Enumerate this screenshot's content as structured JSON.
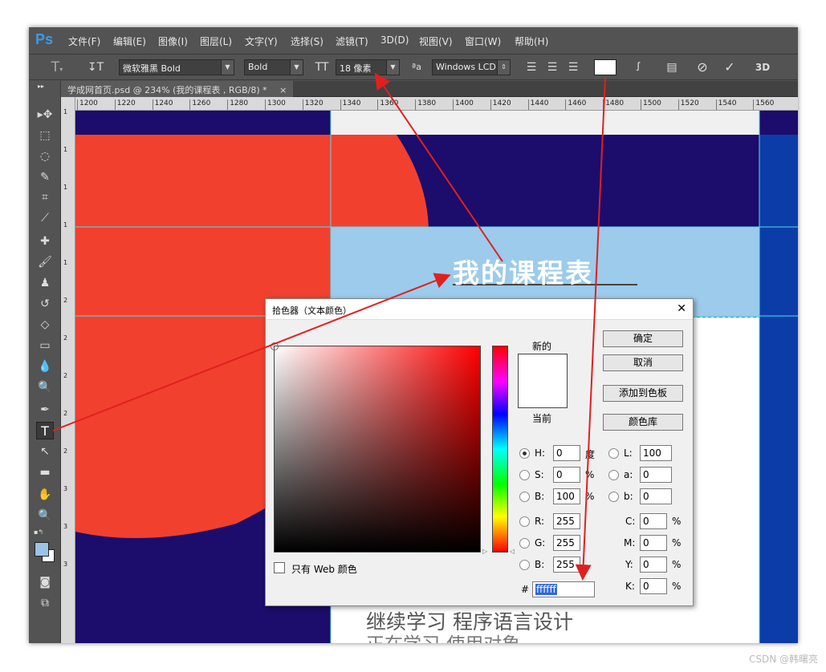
{
  "app": {
    "logo": "Ps"
  },
  "menu": [
    "文件(F)",
    "编辑(E)",
    "图像(I)",
    "图层(L)",
    "文字(Y)",
    "选择(S)",
    "滤镜(T)",
    "3D(D)",
    "视图(V)",
    "窗口(W)",
    "帮助(H)"
  ],
  "options": {
    "font_family": "微软雅黑 Bold",
    "font_style": "Bold",
    "font_size": "18 像素",
    "aa_label": "ªa",
    "antialias": "Windows LCD",
    "label_3d": "3D",
    "text_color": "#ffffff"
  },
  "document": {
    "tab_title": "学成网首页.psd @ 234% (我的课程表 , RGB/8) *",
    "close": "×"
  },
  "ruler": {
    "h": [
      "1200",
      "1220",
      "1240",
      "1260",
      "1280",
      "1300",
      "1320",
      "1340",
      "1360",
      "1380",
      "1400",
      "1420",
      "1440",
      "1460",
      "1480",
      "1500",
      "1520",
      "1540",
      "1560"
    ],
    "v": [
      "1",
      "1",
      "1",
      "1",
      "1",
      "2",
      "2",
      "2",
      "2",
      "2",
      "3",
      "3",
      "3"
    ]
  },
  "canvas": {
    "heading": "我的课程表",
    "line1": "继续学习 程序语言设计",
    "line2": "正在学习-使用对象"
  },
  "picker": {
    "title": "拾色器（文本颜色）",
    "close": "✕",
    "new_label": "新的",
    "current_label": "当前",
    "btn_ok": "确定",
    "btn_cancel": "取消",
    "btn_add": "添加到色板",
    "btn_lib": "颜色库",
    "web_only": "只有 Web 颜色",
    "H": {
      "label": "H:",
      "value": "0",
      "unit": "度"
    },
    "S": {
      "label": "S:",
      "value": "0",
      "unit": "%"
    },
    "Bv": {
      "label": "B:",
      "value": "100",
      "unit": "%"
    },
    "R": {
      "label": "R:",
      "value": "255"
    },
    "G": {
      "label": "G:",
      "value": "255"
    },
    "Bb": {
      "label": "B:",
      "value": "255"
    },
    "L": {
      "label": "L:",
      "value": "100"
    },
    "a": {
      "label": "a:",
      "value": "0"
    },
    "b": {
      "label": "b:",
      "value": "0"
    },
    "C": {
      "label": "C:",
      "value": "0",
      "unit": "%"
    },
    "M": {
      "label": "M:",
      "value": "0",
      "unit": "%"
    },
    "Y": {
      "label": "Y:",
      "value": "0",
      "unit": "%"
    },
    "K": {
      "label": "K:",
      "value": "0",
      "unit": "%"
    },
    "hash": "#",
    "hex": "ffffff",
    "new_color": "#ffffff",
    "current_color": "#ffffff"
  },
  "watermark": "CSDN @韩曙亮"
}
